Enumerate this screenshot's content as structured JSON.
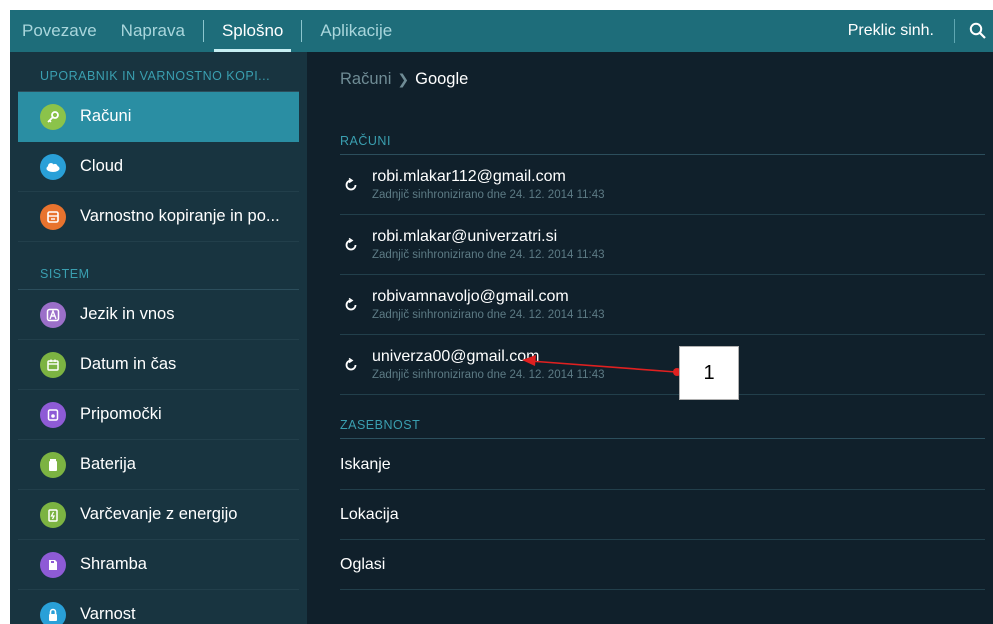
{
  "tabs": [
    {
      "label": "Povezave",
      "active": false
    },
    {
      "label": "Naprava",
      "active": false
    },
    {
      "label": "Splošno",
      "active": true
    },
    {
      "label": "Aplikacije",
      "active": false
    }
  ],
  "toolbar": {
    "cancel_sync": "Preklic sinh."
  },
  "sidebar": {
    "section1": "UPORABNIK IN VARNOSTNO KOPI...",
    "section2": "SISTEM",
    "items": [
      {
        "label": "Računi",
        "icon": "key-icon",
        "color": "#8bc34a",
        "selected": true
      },
      {
        "label": "Cloud",
        "icon": "cloud-icon",
        "color": "#29a0d8"
      },
      {
        "label": "Varnostno kopiranje in po...",
        "icon": "backup-icon",
        "color": "#e8732e"
      },
      {
        "label": "Jezik in vnos",
        "icon": "language-icon",
        "color": "#9b6fc9"
      },
      {
        "label": "Datum in čas",
        "icon": "calendar-icon",
        "color": "#7cb342"
      },
      {
        "label": "Pripomočki",
        "icon": "accessory-icon",
        "color": "#8e5bd6"
      },
      {
        "label": "Baterija",
        "icon": "battery-icon",
        "color": "#7cb342"
      },
      {
        "label": "Varčevanje z energijo",
        "icon": "power-saving-icon",
        "color": "#7cb342"
      },
      {
        "label": "Shramba",
        "icon": "storage-icon",
        "color": "#8e5bd6"
      },
      {
        "label": "Varnost",
        "icon": "lock-icon",
        "color": "#29a0d8"
      }
    ]
  },
  "main": {
    "breadcrumb_parent": "Računi",
    "breadcrumb_current": "Google",
    "accounts_header": "RAČUNI",
    "accounts": [
      {
        "email": "robi.mlakar112@gmail.com",
        "sync": "Zadnjič sinhronizirano dne 24. 12. 2014 11:43"
      },
      {
        "email": "robi.mlakar@univerzatri.si",
        "sync": "Zadnjič sinhronizirano dne 24. 12. 2014 11:43"
      },
      {
        "email": "robivamnavoljo@gmail.com",
        "sync": "Zadnjič sinhronizirano dne 24. 12. 2014 11:43"
      },
      {
        "email": "univerza00@gmail.com",
        "sync": "Zadnjič sinhronizirano dne 24. 12. 2014 11:43"
      }
    ],
    "privacy_header": "ZASEBNOST",
    "privacy_items": [
      "Iskanje",
      "Lokacija",
      "Oglasi"
    ]
  },
  "annotation": {
    "label": "1",
    "color": "#e02020"
  }
}
